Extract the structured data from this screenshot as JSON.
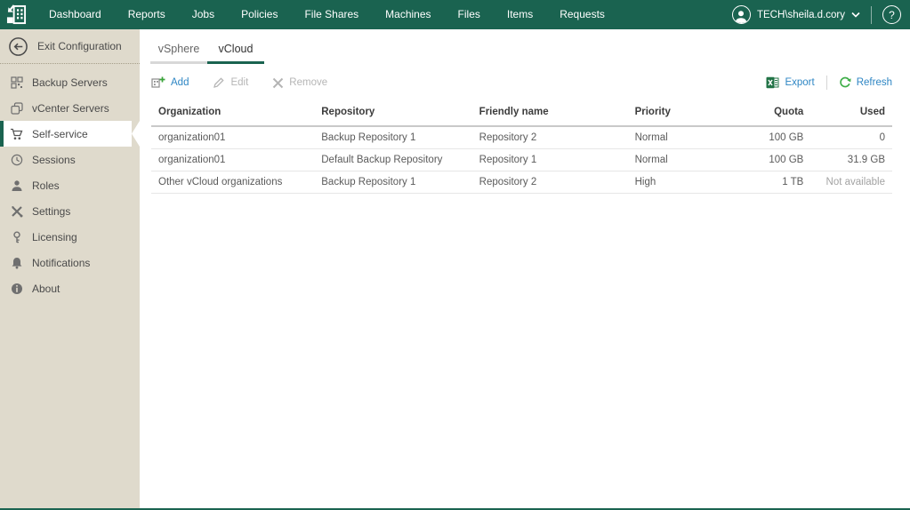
{
  "topnav": {
    "items": [
      "Dashboard",
      "Reports",
      "Jobs",
      "Policies",
      "File Shares",
      "Machines",
      "Files",
      "Items",
      "Requests"
    ],
    "user": "TECH\\sheila.d.cory",
    "help_label": "?"
  },
  "sidebar": {
    "exit_label": "Exit Configuration",
    "items": [
      {
        "label": "Backup Servers",
        "icon": "backup-servers-icon",
        "selected": false
      },
      {
        "label": "vCenter Servers",
        "icon": "vcenter-servers-icon",
        "selected": false
      },
      {
        "label": "Self-service",
        "icon": "self-service-cart-icon",
        "selected": true
      },
      {
        "label": "Sessions",
        "icon": "sessions-clock-icon",
        "selected": false
      },
      {
        "label": "Roles",
        "icon": "roles-person-icon",
        "selected": false
      },
      {
        "label": "Settings",
        "icon": "settings-tools-icon",
        "selected": false
      },
      {
        "label": "Licensing",
        "icon": "licensing-key-icon",
        "selected": false
      },
      {
        "label": "Notifications",
        "icon": "notifications-bell-icon",
        "selected": false
      },
      {
        "label": "About",
        "icon": "about-info-icon",
        "selected": false
      }
    ]
  },
  "tabs": [
    {
      "label": "vSphere",
      "active": false
    },
    {
      "label": "vCloud",
      "active": true
    }
  ],
  "toolbar": {
    "add": "Add",
    "edit": "Edit",
    "remove": "Remove",
    "export": "Export",
    "refresh": "Refresh"
  },
  "table": {
    "columns": [
      "Organization",
      "Repository",
      "Friendly name",
      "Priority",
      "Quota",
      "Used"
    ],
    "rows": [
      {
        "organization": "organization01",
        "repository": "Backup Repository 1",
        "friendly_name": "Repository 2",
        "priority": "Normal",
        "quota": "100 GB",
        "used": "0"
      },
      {
        "organization": "organization01",
        "repository": "Default Backup Repository",
        "friendly_name": "Repository 1",
        "priority": "Normal",
        "quota": "100 GB",
        "used": "31.9 GB"
      },
      {
        "organization": "Other vCloud organizations",
        "repository": "Backup Repository 1",
        "friendly_name": "Repository 2",
        "priority": "High",
        "quota": "1 TB",
        "used": "Not available"
      }
    ]
  },
  "colors": {
    "header_green": "#1a6350",
    "sidebar_beige": "#dfdacc",
    "link_blue": "#2e86c4",
    "excel_green": "#217346",
    "refresh_green": "#3fae49",
    "disabled_gray": "#b5b5b5"
  }
}
